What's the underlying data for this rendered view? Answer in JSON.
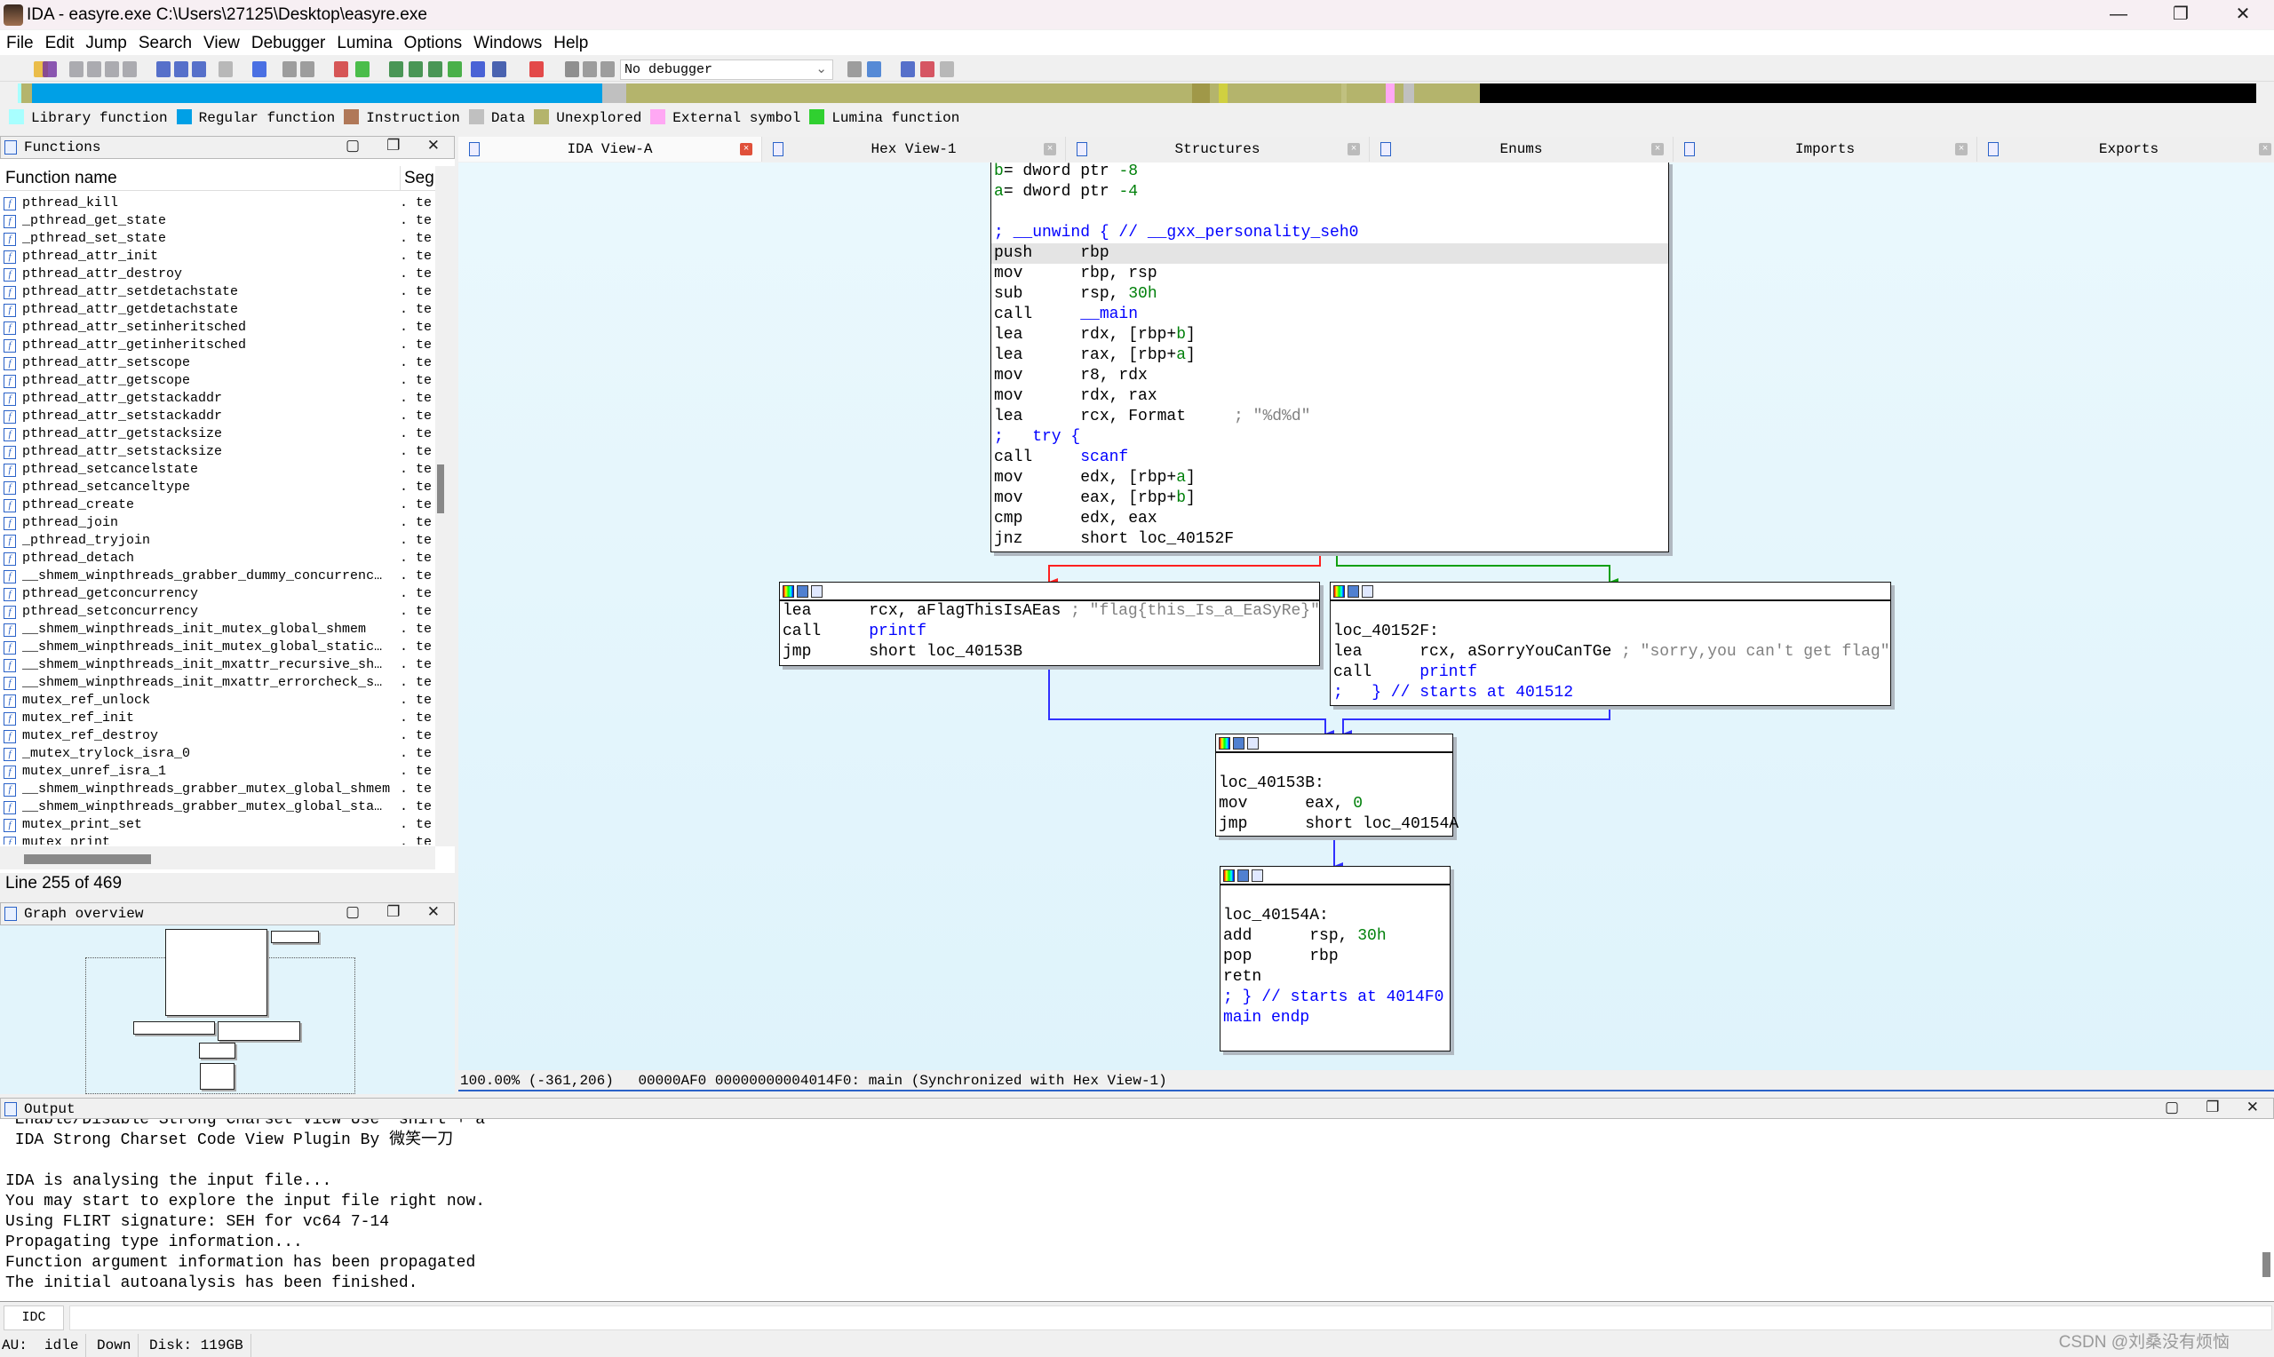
{
  "window": {
    "title": "IDA - easyre.exe C:\\Users\\27125\\Desktop\\easyre.exe",
    "minimize": "—",
    "maximize": "❐",
    "close": "✕"
  },
  "menu": [
    "File",
    "Edit",
    "Jump",
    "Search",
    "View",
    "Debugger",
    "Lumina",
    "Options",
    "Windows",
    "Help"
  ],
  "toolbar": {
    "debugger_select": "No debugger",
    "chevron": "⌄"
  },
  "legend": [
    {
      "label": "Library function",
      "color": "#a8ffff"
    },
    {
      "label": "Regular function",
      "color": "#00a0e6"
    },
    {
      "label": "Instruction",
      "color": "#b07858"
    },
    {
      "label": "Data",
      "color": "#c0c0c0"
    },
    {
      "label": "Unexplored",
      "color": "#b4b46c"
    },
    {
      "label": "External symbol",
      "color": "#ffa8f4"
    },
    {
      "label": "Lumina function",
      "color": "#30d030"
    }
  ],
  "functions_panel": {
    "title": "Functions",
    "buttons": "▢ ❐ ✕",
    "col_name": "Function name",
    "col_seg": "Seg",
    "seg_value": ". te",
    "items": [
      "pthread_kill",
      "_pthread_get_state",
      "_pthread_set_state",
      "pthread_attr_init",
      "pthread_attr_destroy",
      "pthread_attr_setdetachstate",
      "pthread_attr_getdetachstate",
      "pthread_attr_setinheritsched",
      "pthread_attr_getinheritsched",
      "pthread_attr_setscope",
      "pthread_attr_getscope",
      "pthread_attr_getstackaddr",
      "pthread_attr_setstackaddr",
      "pthread_attr_getstacksize",
      "pthread_attr_setstacksize",
      "pthread_setcancelstate",
      "pthread_setcanceltype",
      "pthread_create",
      "pthread_join",
      "_pthread_tryjoin",
      "pthread_detach",
      "__shmem_winpthreads_grabber_dummy_concurrenc…",
      "pthread_getconcurrency",
      "pthread_setconcurrency",
      "__shmem_winpthreads_init_mutex_global_shmem",
      "__shmem_winpthreads_init_mutex_global_static…",
      "__shmem_winpthreads_init_mxattr_recursive_sh…",
      "__shmem_winpthreads_init_mxattr_errorcheck_s…",
      "mutex_ref_unlock",
      "mutex_ref_init",
      "mutex_ref_destroy",
      "_mutex_trylock_isra_0",
      "mutex_unref_isra_1",
      "__shmem_winpthreads_grabber_mutex_global_shmem",
      "__shmem_winpthreads_grabber_mutex_global_sta…",
      "mutex_print_set",
      "mutex_print"
    ],
    "line_info": "Line 255 of 469"
  },
  "graph_overview": {
    "title": "Graph overview",
    "buttons": "▢ ❐ ✕"
  },
  "tabs": [
    {
      "label": "IDA View-A",
      "active": true
    },
    {
      "label": "Hex View-1"
    },
    {
      "label": "Structures"
    },
    {
      "label": "Enums"
    },
    {
      "label": "Imports"
    },
    {
      "label": "Exports"
    }
  ],
  "graph": {
    "nodes": [
      {
        "id": "main",
        "lines": [
          [
            [
              "b",
              "g"
            ],
            [
              "= dword ptr ",
              "k"
            ],
            [
              "-8",
              "g"
            ]
          ],
          [
            [
              "a",
              "g"
            ],
            [
              "= dword ptr ",
              "k"
            ],
            [
              "-4",
              "g"
            ]
          ],
          [],
          [
            [
              "; __unwind { // __gxx_personality_seh0",
              "b"
            ]
          ],
          [
            [
              "push     rbp",
              "k"
            ]
          ],
          [
            [
              "mov      rbp, rsp",
              "k"
            ]
          ],
          [
            [
              "sub      rsp, ",
              "k"
            ],
            [
              "30h",
              "g"
            ]
          ],
          [
            [
              "call     ",
              "k"
            ],
            [
              "__main",
              "b"
            ]
          ],
          [
            [
              "lea      rdx, [rbp+",
              "k"
            ],
            [
              "b",
              "g"
            ],
            [
              "]",
              "k"
            ]
          ],
          [
            [
              "lea      rax, [rbp+",
              "k"
            ],
            [
              "a",
              "g"
            ],
            [
              "]",
              "k"
            ]
          ],
          [
            [
              "mov      r8, rdx",
              "k"
            ]
          ],
          [
            [
              "mov      rdx, rax",
              "k"
            ]
          ],
          [
            [
              "lea      rcx, Format     ",
              "k"
            ],
            [
              "; \"%d%d\"",
              "gr"
            ]
          ],
          [
            [
              ";   try {",
              "b"
            ]
          ],
          [
            [
              "call     ",
              "k"
            ],
            [
              "scanf",
              "b"
            ]
          ],
          [
            [
              "mov      edx, [rbp+",
              "k"
            ],
            [
              "a",
              "g"
            ],
            [
              "]",
              "k"
            ]
          ],
          [
            [
              "mov      eax, [rbp+",
              "k"
            ],
            [
              "b",
              "g"
            ],
            [
              "]",
              "k"
            ]
          ],
          [
            [
              "cmp      edx, eax",
              "k"
            ]
          ],
          [
            [
              "jnz      short loc_40152F",
              "k"
            ]
          ]
        ]
      },
      {
        "id": "flag",
        "lines": [
          [
            [
              "lea      rcx, aFlagThisIsAEas ",
              "k"
            ],
            [
              "; \"flag{this_Is_a_EaSyRe}\"",
              "gr"
            ]
          ],
          [
            [
              "call     ",
              "k"
            ],
            [
              "printf",
              "b"
            ]
          ],
          [
            [
              "jmp      short loc_40153B",
              "k"
            ]
          ]
        ]
      },
      {
        "id": "sorry",
        "lines": [
          [],
          [
            [
              "loc_40152F:",
              "k"
            ]
          ],
          [
            [
              "lea      rcx, aSorryYouCanTGe ",
              "k"
            ],
            [
              "; \"sorry,you can't get flag\"",
              "gr"
            ]
          ],
          [
            [
              "call     ",
              "k"
            ],
            [
              "printf",
              "b"
            ]
          ],
          [
            [
              ";   } // starts at 401512",
              "b"
            ]
          ]
        ]
      },
      {
        "id": "loc_40153B",
        "lines": [
          [],
          [
            [
              "loc_40153B:",
              "k"
            ]
          ],
          [
            [
              "mov      eax, ",
              "k"
            ],
            [
              "0",
              "g"
            ]
          ],
          [
            [
              "jmp      short loc_40154A",
              "k"
            ]
          ]
        ]
      },
      {
        "id": "loc_40154A",
        "lines": [
          [],
          [
            [
              "loc_40154A:",
              "k"
            ]
          ],
          [
            [
              "add      rsp, ",
              "k"
            ],
            [
              "30h",
              "g"
            ]
          ],
          [
            [
              "pop      rbp",
              "k"
            ]
          ],
          [
            [
              "retn",
              "k"
            ]
          ],
          [
            [
              "; } // starts at 4014F0",
              "b"
            ]
          ],
          [
            [
              "main endp",
              "b"
            ]
          ]
        ]
      }
    ],
    "edge_colors": {
      "false": "#ff2020",
      "true": "#10a010",
      "jump": "#3030ff"
    }
  },
  "graph_status": {
    "zoom": "100.00%",
    "coords": "(-361,206)",
    "location": "00000AF0 00000000004014F0: main (Synchronized with Hex View-1)"
  },
  "output": {
    "title": "Output",
    "buttons": "▢ ❐ ✕",
    "lines": [
      " Enable/Disable Strong Charset View Use `shift + a`",
      " IDA Strong Charset Code View Plugin By 微笑一刀",
      "",
      "IDA is analysing the input file...",
      "You may start to explore the input file right now.",
      "Using FLIRT signature: SEH for vc64 7-14",
      "Propagating type information...",
      "Function argument information has been propagated",
      "The initial autoanalysis has been finished."
    ]
  },
  "idc": {
    "label": "IDC"
  },
  "status": {
    "au_label": "AU:",
    "au_value": "idle",
    "direction": "Down",
    "disk": "Disk: 119GB"
  },
  "watermark": "CSDN @刘桑没有烦恼"
}
